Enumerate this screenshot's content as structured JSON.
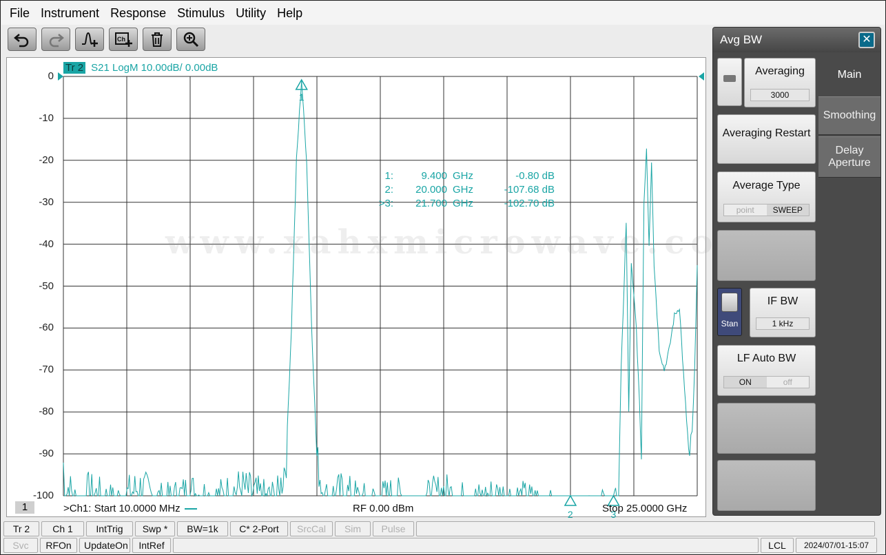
{
  "menu": [
    "File",
    "Instrument",
    "Response",
    "Stimulus",
    "Utility",
    "Help"
  ],
  "toolbar": [
    {
      "name": "undo-button",
      "icon": "undo-icon"
    },
    {
      "name": "redo-button",
      "icon": "redo-icon"
    },
    {
      "name": "add-trace-button",
      "icon": "add-trace-icon"
    },
    {
      "name": "add-channel-button",
      "icon": "add-channel-icon"
    },
    {
      "name": "delete-button",
      "icon": "trash-icon"
    },
    {
      "name": "zoom-button",
      "icon": "magnifier-icon"
    }
  ],
  "trace": {
    "badge": "Tr 2",
    "label": "S21 LogM 10.00dB/  0.00dB"
  },
  "watermark": "www.xahxmicrowave.com",
  "markers": [
    {
      "id": "1:",
      "freq": "9.400",
      "unit": "GHz",
      "value": "-0.80 dB"
    },
    {
      "id": "2:",
      "freq": "20.000",
      "unit": "GHz",
      "value": "-107.68 dB"
    },
    {
      "id": ">3:",
      "freq": "21.700",
      "unit": "GHz",
      "value": "-102.70 dB"
    }
  ],
  "marker_labels": [
    "1",
    "2",
    "3"
  ],
  "chart_data": {
    "type": "line",
    "series": [
      {
        "values": [
          [
            0.01,
            -91
          ],
          [
            0.06,
            -100
          ],
          [
            0.2,
            -97
          ],
          [
            0.6,
            -102
          ],
          [
            1.0,
            -98
          ],
          [
            2.0,
            -101
          ],
          [
            3.0,
            -97
          ],
          [
            4.0,
            -101
          ],
          [
            5.0,
            -98
          ],
          [
            6.0,
            -100
          ],
          [
            7.0,
            -97
          ],
          [
            8.0,
            -100
          ],
          [
            8.5,
            -99
          ],
          [
            8.8,
            -90
          ],
          [
            9.0,
            -60
          ],
          [
            9.2,
            -20
          ],
          [
            9.4,
            -0.8
          ],
          [
            9.6,
            -20
          ],
          [
            9.8,
            -60
          ],
          [
            10.0,
            -90
          ],
          [
            10.3,
            -100
          ],
          [
            11.0,
            -98
          ],
          [
            12.0,
            -101
          ],
          [
            13.0,
            -99
          ],
          [
            14.0,
            -101
          ],
          [
            15.0,
            -98
          ],
          [
            16.0,
            -101
          ],
          [
            17.0,
            -99
          ],
          [
            18.0,
            -100
          ],
          [
            19.0,
            -101
          ],
          [
            20.0,
            -107.68
          ],
          [
            21.0,
            -102
          ],
          [
            21.7,
            -102.7
          ],
          [
            21.9,
            -100
          ],
          [
            22.0,
            -70
          ],
          [
            22.2,
            -35
          ],
          [
            22.3,
            -80
          ],
          [
            22.4,
            -45
          ],
          [
            22.6,
            -60
          ],
          [
            22.8,
            -90
          ],
          [
            22.9,
            -30
          ],
          [
            23.0,
            -17
          ],
          [
            23.1,
            -40
          ],
          [
            23.2,
            -20
          ],
          [
            23.3,
            -45
          ],
          [
            23.5,
            -65
          ],
          [
            23.7,
            -70
          ],
          [
            23.9,
            -65
          ],
          [
            24.1,
            -57
          ],
          [
            24.3,
            -55
          ],
          [
            24.5,
            -75
          ],
          [
            24.7,
            -92
          ],
          [
            24.8,
            -85
          ],
          [
            24.9,
            -70
          ],
          [
            25.0,
            -45
          ]
        ]
      }
    ],
    "xlim": [
      0.01,
      25.0
    ],
    "ylim": [
      -100,
      0
    ],
    "y_ticks": [
      0,
      -10,
      -20,
      -30,
      -40,
      -50,
      -60,
      -70,
      -80,
      -90,
      -100
    ],
    "grid": true
  },
  "channel": {
    "badge": "1",
    "start": ">Ch1:  Start   10.0000 MHz",
    "rf": "RF    0.00 dBm",
    "stop": "Stop  25.0000 GHz"
  },
  "side": {
    "title": "Avg BW",
    "close": "✕",
    "tabs": [
      "Main",
      "Smoothing",
      "Delay Aperture"
    ],
    "averaging": {
      "label": "Averaging",
      "value": "3000"
    },
    "averaging_restart": "Averaging Restart",
    "average_type": {
      "label": "Average Type",
      "opt_a": "point",
      "opt_b": "SWEEP"
    },
    "stan_label": "Stan",
    "if_bw": {
      "label": "IF BW",
      "value": "1 kHz"
    },
    "lf_auto_bw": {
      "label": "LF Auto BW",
      "opt_a": "ON",
      "opt_b": "off"
    }
  },
  "status_top": [
    "Tr 2",
    "Ch 1",
    "IntTrig",
    "Swp *",
    "BW=1k",
    "C* 2-Port",
    "SrcCal",
    "Sim",
    "Pulse"
  ],
  "status_bottom": [
    "Svc",
    "RFOn",
    "UpdateOn",
    "IntRef"
  ],
  "status_right": {
    "lcl": "LCL",
    "datetime": "2024/07/01-15:07"
  },
  "colors": {
    "trace": "#1aa5a5",
    "grid": "#333333"
  }
}
